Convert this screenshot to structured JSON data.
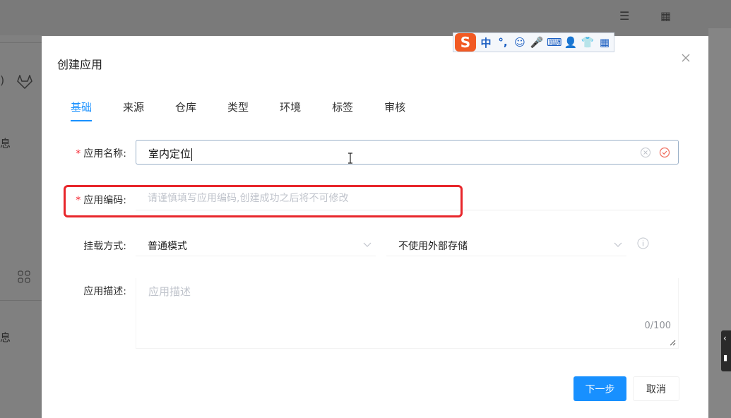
{
  "background": {
    "left_text_1": "息",
    "left_text_2": "息"
  },
  "ime_toolbar": {
    "logo": "S",
    "items": [
      "中",
      "°,",
      "☺",
      "🎤",
      "⌨",
      "👤",
      "👕",
      "▦"
    ]
  },
  "modal": {
    "title": "创建应用",
    "tabs": [
      {
        "label": "基础",
        "active": true
      },
      {
        "label": "来源",
        "active": false
      },
      {
        "label": "仓库",
        "active": false
      },
      {
        "label": "类型",
        "active": false
      },
      {
        "label": "环境",
        "active": false
      },
      {
        "label": "标签",
        "active": false
      },
      {
        "label": "审核",
        "active": false
      }
    ],
    "form": {
      "app_name": {
        "label": "应用名称:",
        "required_mark": "*",
        "value": "室内定位"
      },
      "app_code": {
        "label": "应用编码:",
        "required_mark": "*",
        "placeholder": "请谨慎填写应用编码,创建成功之后将不可修改"
      },
      "mount": {
        "label": "挂载方式:",
        "mode_value": "普通模式",
        "storage_value": "不使用外部存储"
      },
      "description": {
        "label": "应用描述:",
        "placeholder": "应用描述",
        "counter": "0/100"
      }
    },
    "buttons": {
      "next": "下一步",
      "cancel": "取消"
    }
  },
  "colors": {
    "primary": "#1890ff",
    "highlight": "#e8262b",
    "required": "#f5222d",
    "success": "#f06a5a"
  }
}
